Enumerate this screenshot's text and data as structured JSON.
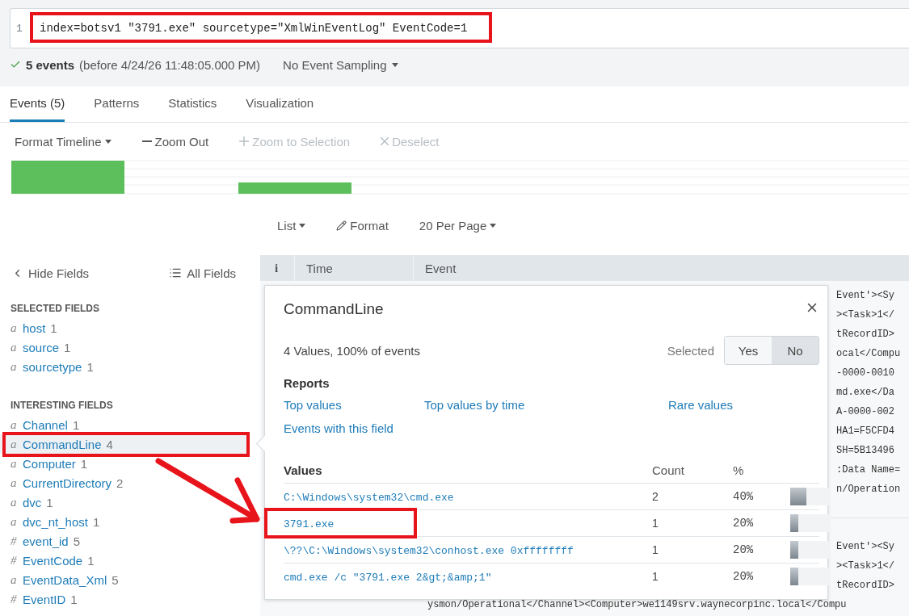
{
  "query": {
    "line_number": "1",
    "text": "index=botsv1 \"3791.exe\" sourcetype=\"XmlWinEventLog\" EventCode=1"
  },
  "status": {
    "count": "5 events",
    "range": "(before 4/24/26 11:48:05.000 PM)",
    "sampling": "No Event Sampling"
  },
  "tabs": [
    {
      "label": "Events (5)",
      "selected": true
    },
    {
      "label": "Patterns",
      "selected": false
    },
    {
      "label": "Statistics",
      "selected": false
    },
    {
      "label": "Visualization",
      "selected": false
    }
  ],
  "timeline_controls": [
    {
      "label": "Format Timeline",
      "kind": "dropdown",
      "disabled": false
    },
    {
      "label": "Zoom Out",
      "kind": "minus",
      "disabled": false
    },
    {
      "label": "Zoom to Selection",
      "kind": "plus",
      "disabled": true
    },
    {
      "label": "Deselect",
      "kind": "close",
      "disabled": true
    }
  ],
  "view_controls": [
    {
      "label": "List",
      "kind": "dropdown"
    },
    {
      "label": "Format",
      "kind": "pencil"
    },
    {
      "label": "20 Per Page",
      "kind": "dropdown"
    }
  ],
  "sidebar": {
    "hide_fields": "Hide Fields",
    "all_fields": "All Fields",
    "sections": [
      {
        "title": "SELECTED FIELDS",
        "fields": [
          {
            "type": "a",
            "name": "host",
            "count": "1",
            "selected": false
          },
          {
            "type": "a",
            "name": "source",
            "count": "1",
            "selected": false
          },
          {
            "type": "a",
            "name": "sourcetype",
            "count": "1",
            "selected": false
          }
        ]
      },
      {
        "title": "INTERESTING FIELDS",
        "fields": [
          {
            "type": "a",
            "name": "Channel",
            "count": "1",
            "selected": false
          },
          {
            "type": "a",
            "name": "CommandLine",
            "count": "4",
            "selected": true
          },
          {
            "type": "a",
            "name": "Computer",
            "count": "1",
            "selected": false
          },
          {
            "type": "a",
            "name": "CurrentDirectory",
            "count": "2",
            "selected": false
          },
          {
            "type": "a",
            "name": "dvc",
            "count": "1",
            "selected": false
          },
          {
            "type": "a",
            "name": "dvc_nt_host",
            "count": "1",
            "selected": false
          },
          {
            "type": "#",
            "name": "event_id",
            "count": "5",
            "selected": false
          },
          {
            "type": "#",
            "name": "EventCode",
            "count": "1",
            "selected": false
          },
          {
            "type": "a",
            "name": "EventData_Xml",
            "count": "5",
            "selected": false
          },
          {
            "type": "#",
            "name": "EventID",
            "count": "1",
            "selected": false
          }
        ]
      }
    ]
  },
  "table": {
    "columns": [
      "i",
      "Time",
      "Event"
    ],
    "events": [
      {
        "fragments": [
          "Event'><Sy",
          "><Task>1</",
          "tRecordID>",
          "ocal</Compu",
          "-0000-0010",
          "md.exe</Da",
          "A-0000-002",
          "HA1=F5CFD4",
          "SH=5B13496",
          ":Data Name=",
          "n/Operation"
        ]
      },
      {
        "fragments": [
          "Event'><Sy",
          "><Task>1</",
          "tRecordID>"
        ],
        "last_line": "ysmon/Operational</Channel><Computer>we1149srv.waynecorpinc.local</Compu"
      }
    ]
  },
  "popup": {
    "title": "CommandLine",
    "summary": "4 Values, 100% of events",
    "selected_label": "Selected",
    "toggle": [
      {
        "label": "Yes",
        "selected": false
      },
      {
        "label": "No",
        "selected": true
      }
    ],
    "reports_title": "Reports",
    "reports": [
      "Top values",
      "Top values by time",
      "Rare values"
    ],
    "events_link": "Events with this field",
    "value_columns": [
      "Values",
      "Count",
      "%"
    ],
    "values": [
      {
        "value": "C:\\Windows\\system32\\cmd.exe",
        "count": "2",
        "percent": "40%",
        "level": 0.4
      },
      {
        "value": "3791.exe",
        "count": "1",
        "percent": "20%",
        "level": 0.2
      },
      {
        "value": "\\??\\C:\\Windows\\system32\\conhost.exe 0xffffffff",
        "count": "1",
        "percent": "20%",
        "level": 0.2
      },
      {
        "value": "cmd.exe /c \"3791.exe 2&gt;&amp;1\"",
        "count": "1",
        "percent": "20%",
        "level": 0.2
      }
    ]
  }
}
